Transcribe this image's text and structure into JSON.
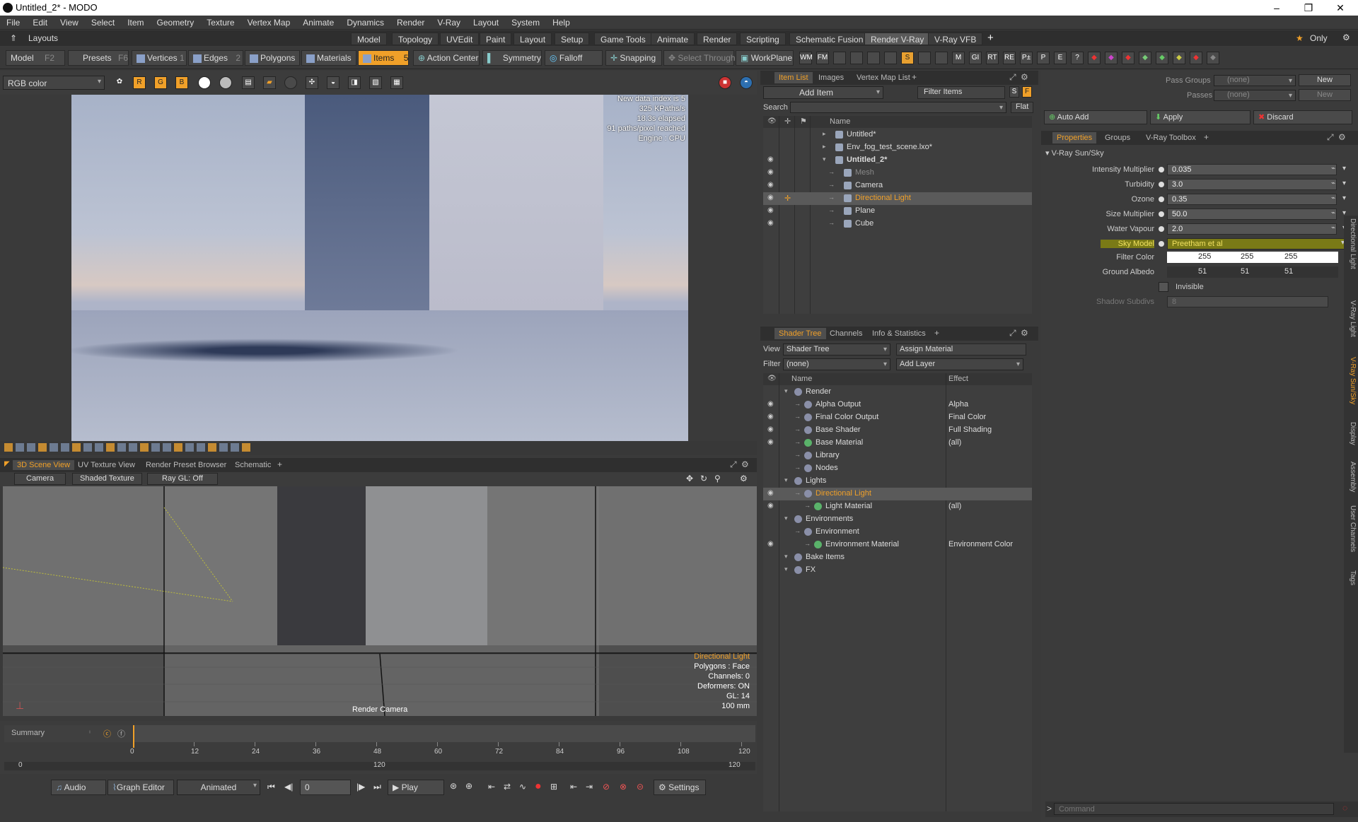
{
  "window": {
    "title": "Untitled_2* - MODO",
    "controls": [
      "–",
      "❐",
      "✕"
    ]
  },
  "menu": [
    "File",
    "Edit",
    "View",
    "Select",
    "Item",
    "Geometry",
    "Texture",
    "Vertex Map",
    "Animate",
    "Dynamics",
    "Render",
    "V-Ray",
    "Layout",
    "System",
    "Help"
  ],
  "layouts": {
    "label": "Layouts",
    "tabs": [
      "Model",
      "Topology",
      "UVEdit",
      "Paint",
      "Layout",
      "Setup",
      "Game Tools",
      "Animate",
      "Render",
      "Scripting",
      "Schematic Fusion",
      "Render V-Ray",
      "V-Ray VFB"
    ],
    "selected": "Render V-Ray",
    "only": "Only"
  },
  "toolbar": {
    "model": "Model",
    "model_key": "F2",
    "presets": "Presets",
    "presets_key": "F6",
    "vertices": "Vertices",
    "vertices_n": "1",
    "edges": "Edges",
    "edges_n": "2",
    "polygons": "Polygons",
    "materials": "Materials",
    "items": "Items",
    "items_n": "5",
    "action_center": "Action Center",
    "symmetry": "Symmetry",
    "falloff": "Falloff",
    "snapping": "Snapping",
    "select_through": "Select Through",
    "workplane": "WorkPlane",
    "vray_btns": [
      "WM",
      "FM",
      "",
      "",
      "",
      "",
      "S",
      "",
      "",
      "M",
      "GI",
      "RT",
      "RE",
      "P±",
      "P",
      "E",
      "?"
    ]
  },
  "viewport": {
    "color_mode": "RGB color",
    "stats": [
      "New data index is 5",
      "325 KPaths/s",
      "18.3s elapsed",
      "91 paths/pixel reached",
      "Engine : CPU"
    ]
  },
  "scene_tabs": {
    "tabs": [
      "3D Scene View",
      "UV Texture View",
      "Render Preset Browser",
      "Schematic"
    ],
    "selected": "3D Scene View"
  },
  "scene_bar": {
    "camera": "Camera",
    "shading": "Shaded Texture",
    "raygl": "Ray GL: Off"
  },
  "scene_info": {
    "lines": [
      "Directional Light",
      "Polygons : Face",
      "Channels: 0",
      "Deformers: ON",
      "GL: 14",
      "100 mm"
    ],
    "render_camera": "Render Camera"
  },
  "timeline": {
    "label": "Summary",
    "ticks": [
      "0",
      "12",
      "24",
      "36",
      "48",
      "60",
      "72",
      "84",
      "96",
      "108",
      "120"
    ],
    "bottom_start": "0",
    "bottom_mid": "120",
    "bottom_end": "120"
  },
  "transport": {
    "audio": "Audio",
    "graph_editor": "Graph Editor",
    "animated": "Animated",
    "frame": "0",
    "play": "Play",
    "settings": "Settings"
  },
  "item_list": {
    "tabs": [
      "Item List",
      "Images",
      "Vertex Map List"
    ],
    "selected": "Item List",
    "add_item": "Add Item",
    "filter_items": "Filter Items",
    "search_label": "Search",
    "flat": "Flat",
    "col_name": "Name",
    "items": [
      {
        "name": "Untitled*",
        "bold": false,
        "eye": false
      },
      {
        "name": "Env_fog_test_scene.lxo*",
        "bold": false,
        "eye": false
      },
      {
        "name": "Untitled_2*",
        "bold": true,
        "eye": true
      },
      {
        "name": "Mesh",
        "bold": false,
        "eye": true,
        "dim": true
      },
      {
        "name": "Camera",
        "bold": false,
        "eye": true
      },
      {
        "name": "Directional Light",
        "bold": false,
        "eye": true,
        "selected": true
      },
      {
        "name": "Plane",
        "bold": false,
        "eye": true
      },
      {
        "name": "Cube",
        "bold": false,
        "eye": true
      }
    ]
  },
  "shader_tree": {
    "tabs": [
      "Shader Tree",
      "Channels",
      "Info & Statistics"
    ],
    "selected": "Shader Tree",
    "view_label": "View",
    "view_value": "Shader Tree",
    "assign_material": "Assign Material",
    "filter_label": "Filter",
    "filter_value": "(none)",
    "add_layer": "Add Layer",
    "col_name": "Name",
    "col_effect": "Effect",
    "rows": [
      {
        "name": "Render",
        "effect": "",
        "eye": false,
        "indent": 0
      },
      {
        "name": "Alpha Output",
        "effect": "Alpha",
        "eye": true,
        "indent": 1
      },
      {
        "name": "Final Color Output",
        "effect": "Final Color",
        "eye": true,
        "indent": 1
      },
      {
        "name": "Base Shader",
        "effect": "Full Shading",
        "eye": true,
        "indent": 1
      },
      {
        "name": "Base Material",
        "effect": "(all)",
        "eye": true,
        "indent": 1
      },
      {
        "name": "Library",
        "effect": "",
        "eye": false,
        "indent": 1
      },
      {
        "name": "Nodes",
        "effect": "",
        "eye": false,
        "indent": 1
      },
      {
        "name": "Lights",
        "effect": "",
        "eye": false,
        "indent": 0
      },
      {
        "name": "Directional Light",
        "effect": "",
        "eye": true,
        "indent": 1,
        "selected": true
      },
      {
        "name": "Light Material",
        "effect": "(all)",
        "eye": true,
        "indent": 2
      },
      {
        "name": "Environments",
        "effect": "",
        "eye": false,
        "indent": 0
      },
      {
        "name": "Environment",
        "effect": "",
        "eye": false,
        "indent": 1
      },
      {
        "name": "Environment Material",
        "effect": "Environment Color",
        "eye": true,
        "indent": 2
      },
      {
        "name": "Bake Items",
        "effect": "",
        "eye": false,
        "indent": 0
      },
      {
        "name": "FX",
        "effect": "",
        "eye": false,
        "indent": 0
      }
    ]
  },
  "passes": {
    "pass_groups_label": "Pass Groups",
    "pass_groups_value": "(none)",
    "passes_label": "Passes",
    "passes_value": "(none)",
    "new1": "New",
    "new2": "New",
    "auto_add": "Auto Add",
    "apply": "Apply",
    "discard": "Discard"
  },
  "properties": {
    "tabs": [
      "Properties",
      "Groups",
      "V-Ray Toolbox"
    ],
    "selected": "Properties",
    "section": "V-Ray Sun/Sky",
    "rows": [
      {
        "label": "Intensity Multiplier",
        "value": "0.035"
      },
      {
        "label": "Turbidity",
        "value": "3.0"
      },
      {
        "label": "Ozone",
        "value": "0.35"
      },
      {
        "label": "Size Multiplier",
        "value": "50.0"
      },
      {
        "label": "Water Vapour",
        "value": "2.0"
      },
      {
        "label": "Sky Model",
        "value": "Preetham et al"
      }
    ],
    "filter_color_label": "Filter Color",
    "filter_color": [
      "255",
      "255",
      "255"
    ],
    "ground_albedo_label": "Ground Albedo",
    "ground_albedo": [
      "51",
      "51",
      "51"
    ],
    "invisible_label": "Invisible",
    "shadow_subdivs_label": "Shadow Subdivs",
    "shadow_subdivs": "8"
  },
  "side_tabs": [
    "Directional Light",
    "V-Ray Light",
    "V-Ray Sun/Sky",
    "Display",
    "Assembly",
    "User Channels",
    "Tags"
  ],
  "command": {
    "placeholder": "Command"
  },
  "colors": {
    "accent": "#f0a029",
    "highlight": "#7a7a16"
  }
}
